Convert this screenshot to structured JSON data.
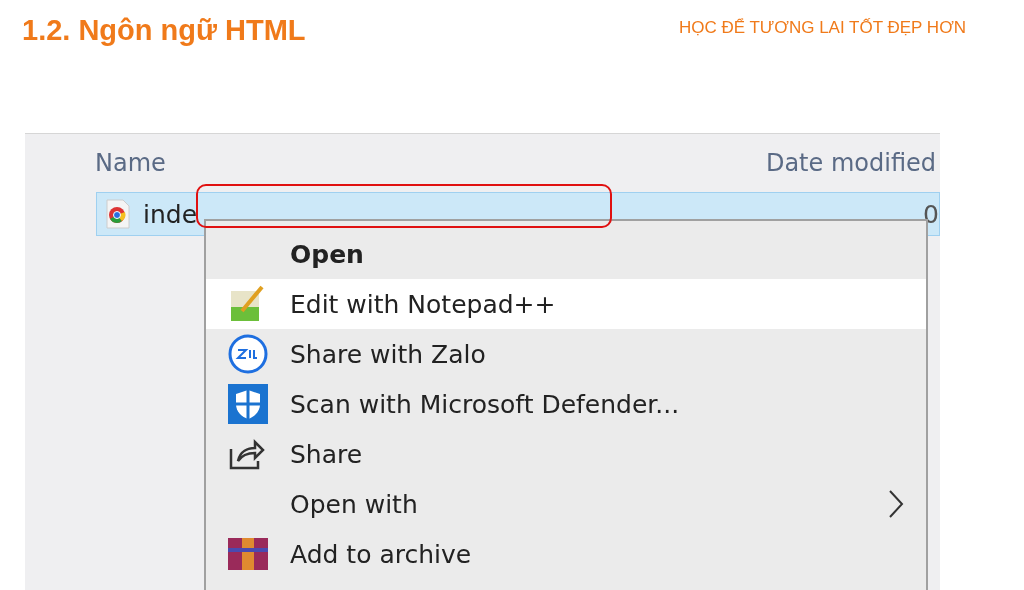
{
  "slide": {
    "title": "1.2. Ngôn ngữ HTML",
    "tagline": "HỌC ĐỂ TƯƠNG LAI TỐT ĐẸP HƠN"
  },
  "explorer": {
    "columns": [
      "Name",
      "Date modified"
    ],
    "file": {
      "name": "inde",
      "date": "0",
      "selected": true
    },
    "context_menu": [
      {
        "kind": "plain",
        "label": "Open",
        "bold": true,
        "hovered": false
      },
      {
        "kind": "notepad",
        "label": "Edit with Notepad++",
        "bold": false,
        "hovered": true
      },
      {
        "kind": "zalo",
        "label": "Share with Zalo",
        "bold": false,
        "hovered": false
      },
      {
        "kind": "defender",
        "label": "Scan with Microsoft Defender...",
        "bold": false,
        "hovered": false
      },
      {
        "kind": "share",
        "label": "Share",
        "bold": false,
        "hovered": false
      },
      {
        "kind": "submenu",
        "label": "Open with",
        "bold": false,
        "hovered": false
      },
      {
        "kind": "archive",
        "label": "Add to archive",
        "bold": false,
        "hovered": false
      }
    ]
  }
}
